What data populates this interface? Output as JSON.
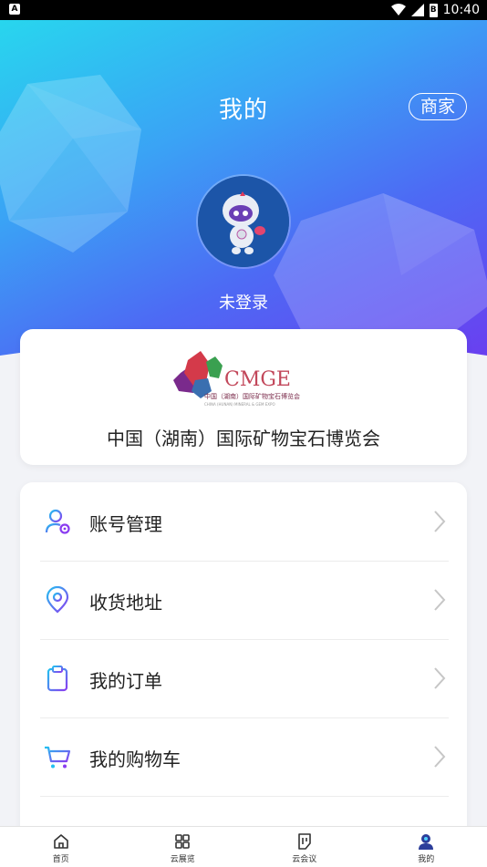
{
  "status_bar": {
    "time": "10:40",
    "app_icon": "A",
    "battery": "B"
  },
  "header": {
    "title": "我的",
    "merchant_button": "商家",
    "login_status": "未登录"
  },
  "expo": {
    "logo_text": "CMGE",
    "logo_subtitle": "中国（湖南）国际矿物宝石博览会",
    "logo_english": "CHINA (HUNAN) MINERAL & GEM EXPO",
    "name": "中国（湖南）国际矿物宝石博览会"
  },
  "menu": [
    {
      "label": "账号管理",
      "icon": "account-settings-icon"
    },
    {
      "label": "收货地址",
      "icon": "location-pin-icon"
    },
    {
      "label": "我的订单",
      "icon": "clipboard-icon"
    },
    {
      "label": "我的购物车",
      "icon": "shopping-cart-icon"
    }
  ],
  "tabbar": [
    {
      "label": "首页",
      "icon": "home-icon"
    },
    {
      "label": "云展览",
      "icon": "grid-icon"
    },
    {
      "label": "云会议",
      "icon": "document-icon"
    },
    {
      "label": "我的",
      "icon": "user-icon",
      "active": true
    }
  ],
  "colors": {
    "accent": "#4d6af4",
    "gradient_start": "#28d6ee",
    "gradient_end": "#6b3df0",
    "icon_gradient_start": "#22c0f0",
    "icon_gradient_end": "#8a3cf0"
  }
}
